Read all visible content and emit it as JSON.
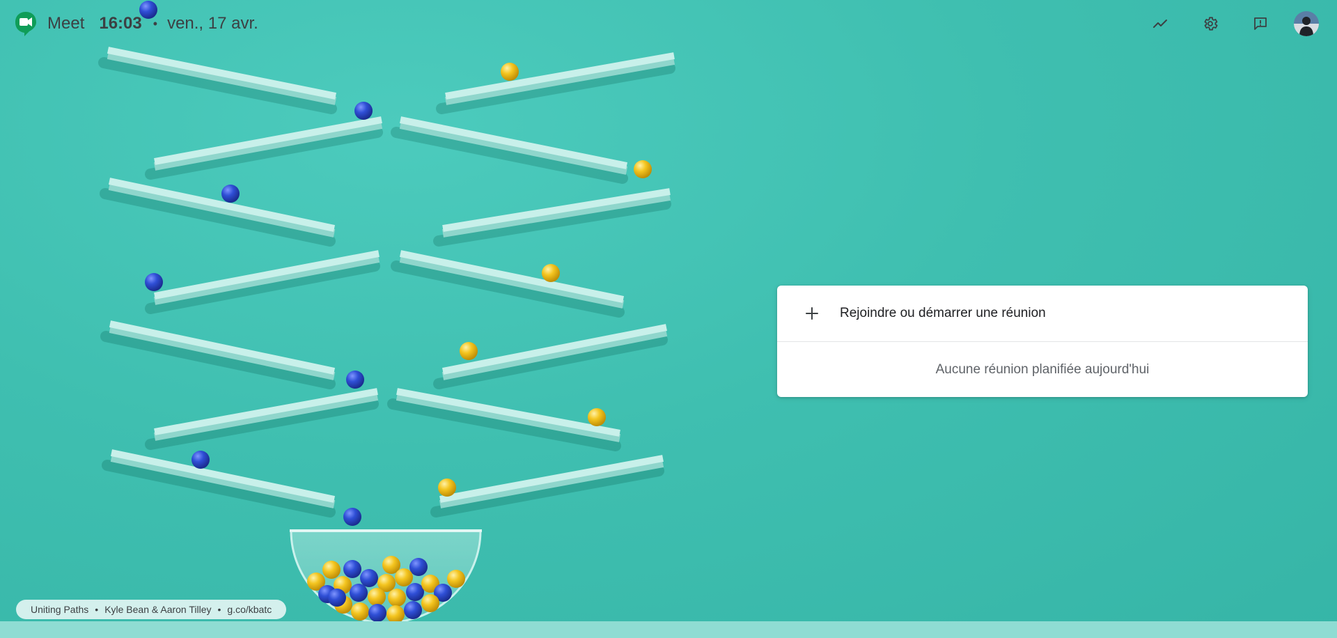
{
  "header": {
    "app_name": "Meet",
    "time": "16:03",
    "separator": "•",
    "date": "ven., 17 avr."
  },
  "icons": {
    "logo": "google-meet-logo",
    "statistics": "trending-up-icon",
    "settings": "gear-icon",
    "feedback": "feedback-icon",
    "avatar": "account-avatar"
  },
  "card": {
    "join_label": "Rejoindre ou démarrer une réunion",
    "empty_label": "Aucune réunion planifiée aujourd'hui"
  },
  "credit": {
    "title": "Uniting Paths",
    "separator": "•",
    "authors": "Kyle Bean & Aaron Tilley",
    "link": "g.co/kbatc"
  },
  "colors": {
    "background": "#40c0b2",
    "shelf": "#c8f0ea",
    "blue_marble": "#2a47c9",
    "yellow_marble": "#f2c21d",
    "card": "#ffffff"
  }
}
